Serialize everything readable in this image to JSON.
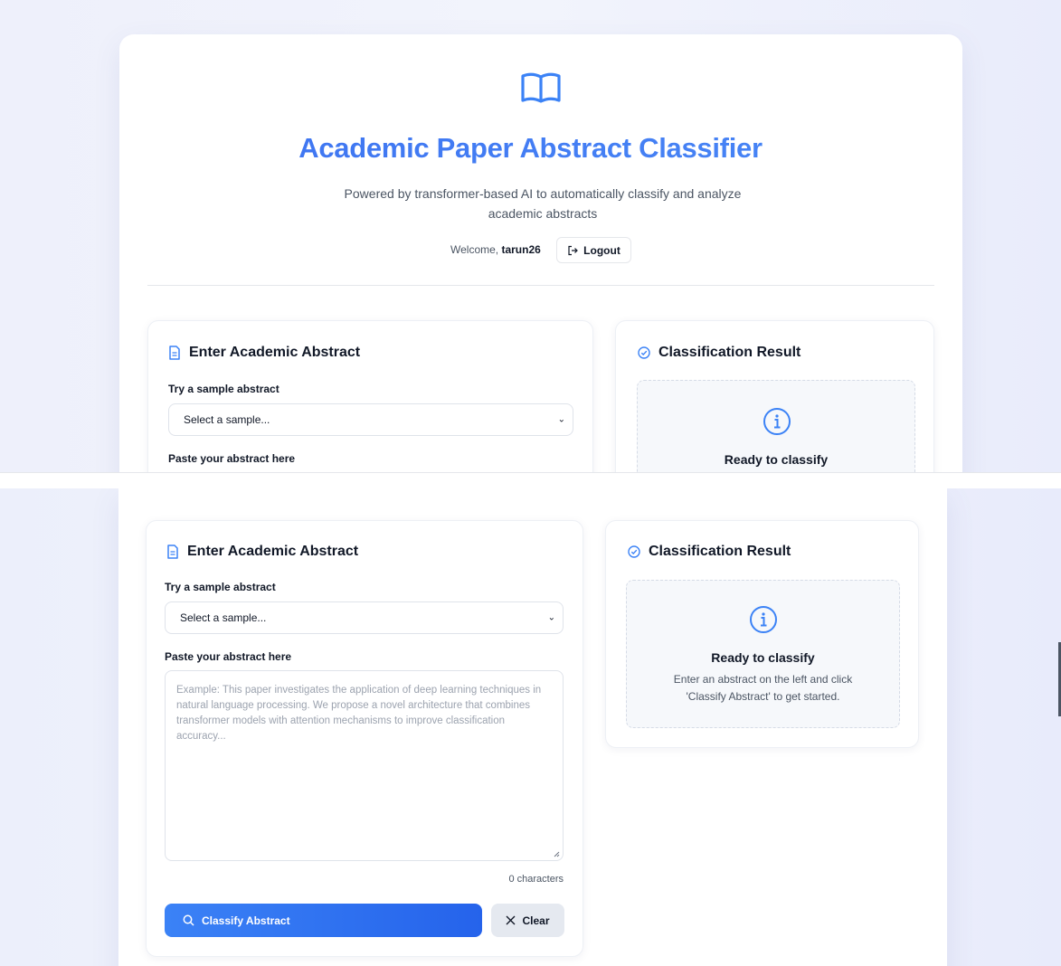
{
  "app": {
    "title": "Academic Paper Abstract Classifier",
    "subtitle": "Powered by transformer-based AI to automatically classify and analyze academic abstracts",
    "welcome_prefix": "Welcome, ",
    "username": "tarun26",
    "logout_label": "Logout",
    "accent_color": "#3b82f6"
  },
  "input_card": {
    "title": "Enter Academic Abstract",
    "sample_label": "Try a sample abstract",
    "sample_selected": "Select a sample...",
    "abstract_label": "Paste your abstract here",
    "abstract_placeholder": "Example: This paper investigates the application of deep learning techniques in natural language processing. We propose a novel architecture that combines transformer models with attention mechanisms to improve classification accuracy...",
    "char_count": "0 characters",
    "classify_label": "Classify Abstract",
    "clear_label": "Clear"
  },
  "result_card": {
    "title": "Classification Result",
    "ready_title": "Ready to classify",
    "ready_text": "Enter an abstract on the left and click 'Classify Abstract' to get started."
  },
  "icons": {
    "header": "book-open-icon",
    "logout": "logout-icon",
    "input_card": "document-icon",
    "result_card": "check-circle-icon",
    "info": "info-icon",
    "search": "search-icon",
    "clear": "close-icon"
  }
}
